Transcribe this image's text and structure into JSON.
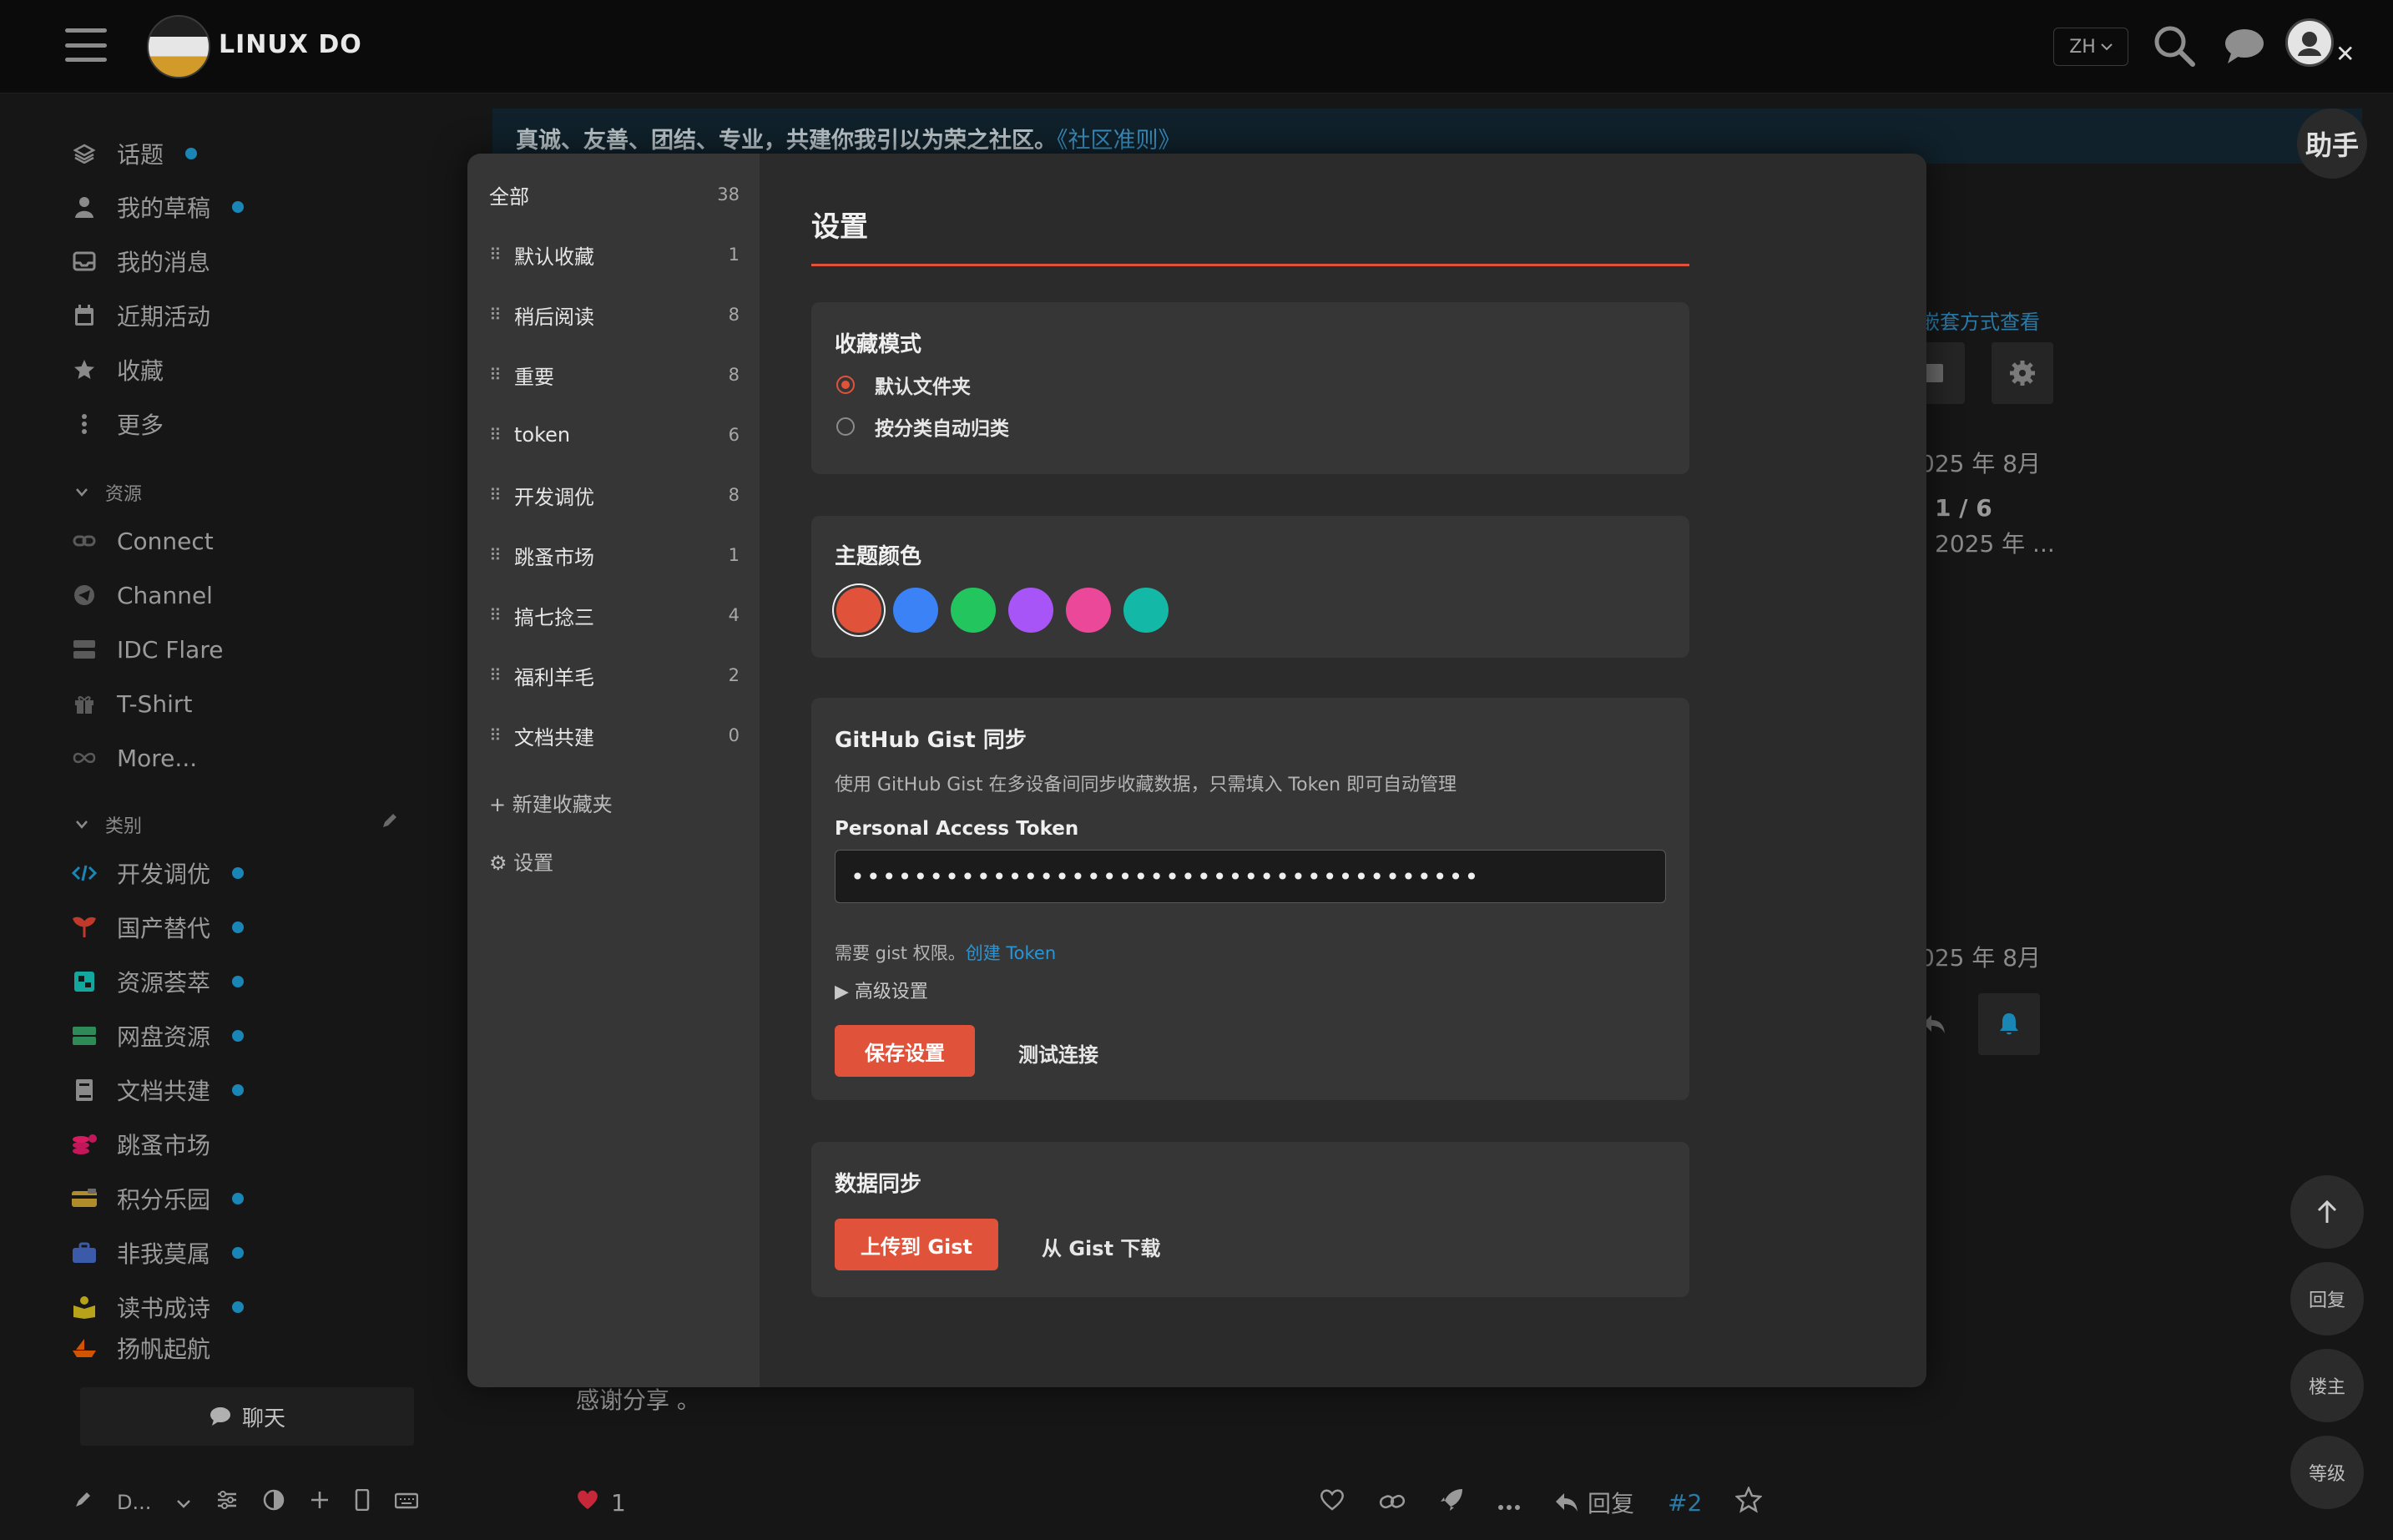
{
  "header": {
    "site_title": "LINUX DO",
    "lang": "ZH"
  },
  "sidebar": {
    "items": [
      {
        "label": "话题",
        "icon": "layers-icon",
        "dot": true
      },
      {
        "label": "我的草稿",
        "icon": "user-icon",
        "dot": true
      },
      {
        "label": "我的消息",
        "icon": "inbox-icon",
        "dot": false
      },
      {
        "label": "近期活动",
        "icon": "calendar-icon",
        "dot": false
      },
      {
        "label": "收藏",
        "icon": "star-icon",
        "dot": false
      },
      {
        "label": "更多",
        "icon": "more-vertical-icon",
        "dot": false
      }
    ],
    "resources_header": "资源",
    "resources": [
      {
        "label": "Connect",
        "icon": "link-icon"
      },
      {
        "label": "Channel",
        "icon": "telegram-icon"
      },
      {
        "label": "IDC Flare",
        "icon": "server-icon"
      },
      {
        "label": "T-Shirt",
        "icon": "gift-icon"
      },
      {
        "label": "More...",
        "icon": "infinity-icon"
      }
    ],
    "categories_header": "类别",
    "categories": [
      {
        "label": "开发调优",
        "icon": "code-icon",
        "color": "#1a86b6"
      },
      {
        "label": "国产替代",
        "icon": "sprout-icon",
        "color": "#c0392b"
      },
      {
        "label": "资源荟萃",
        "icon": "box-icon",
        "color": "#12a89d"
      },
      {
        "label": "网盘资源",
        "icon": "drive-icon",
        "color": "#2e8b57"
      },
      {
        "label": "文档共建",
        "icon": "book-icon",
        "color": "#8a8a8a"
      },
      {
        "label": "跳蚤市场",
        "icon": "coins-icon",
        "color": "#c2185b"
      },
      {
        "label": "积分乐园",
        "icon": "card-icon",
        "color": "#b08d2a"
      },
      {
        "label": "非我莫属",
        "icon": "briefcase-icon",
        "color": "#3b5ba9"
      },
      {
        "label": "读书成诗",
        "icon": "reader-icon",
        "color": "#b8a21a"
      },
      {
        "label": "扬帆起航",
        "icon": "boat-icon",
        "color": "#d35400"
      }
    ],
    "chat_label": "聊天",
    "bottom_label": "D..."
  },
  "banner": {
    "text": "真诚、友善、团结、专业，共建你我引以为荣之社区。",
    "link": "《社区准则》",
    "helper": "助手"
  },
  "background": {
    "nested_view": "嵌套方式查看",
    "date1": "025 年 8月",
    "progress": "1 / 6",
    "date2": "2025 年 ...",
    "date3": "025 年 8月",
    "thanks": "感谢分享 。",
    "likes": "1",
    "reply_label": "回复",
    "post_number": "#2",
    "float_reply": "回复",
    "float_owner": "楼主",
    "float_level": "等级"
  },
  "modal": {
    "folders_all": {
      "label": "全部",
      "count": "38"
    },
    "folders": [
      {
        "label": "默认收藏",
        "count": "1"
      },
      {
        "label": "稍后阅读",
        "count": "8"
      },
      {
        "label": "重要",
        "count": "8"
      },
      {
        "label": "token",
        "count": "6"
      },
      {
        "label": "开发调优",
        "count": "8"
      },
      {
        "label": "跳蚤市场",
        "count": "1"
      },
      {
        "label": "搞七捻三",
        "count": "4"
      },
      {
        "label": "福利羊毛",
        "count": "2"
      },
      {
        "label": "文档共建",
        "count": "0"
      }
    ],
    "new_folder": "+ 新建收藏夹",
    "settings_link": "⚙ 设置",
    "title": "设置",
    "mode": {
      "title": "收藏模式",
      "options": [
        "默认文件夹",
        "按分类自动归类"
      ],
      "selected": "默认文件夹"
    },
    "theme": {
      "title": "主题颜色",
      "colors": [
        "#e0533a",
        "#3b82f6",
        "#22c55e",
        "#a855f7",
        "#ec4899",
        "#14b8a6"
      ],
      "selected": "#e0533a"
    },
    "gist": {
      "title": "GitHub Gist 同步",
      "description": "使用 GitHub Gist 在多设备间同步收藏数据，只需填入 Token 即可自动管理",
      "token_label": "Personal Access Token",
      "token_value": "••••••••••••••••••••••••••••••••••••••••",
      "hint": "需要 gist 权限。",
      "hint_link": "创建 Token",
      "advanced": "▶ 高级设置",
      "save": "保存设置",
      "test": "测试连接"
    },
    "sync": {
      "title": "数据同步",
      "upload": "上传到 Gist",
      "download": "从 Gist 下载"
    }
  }
}
